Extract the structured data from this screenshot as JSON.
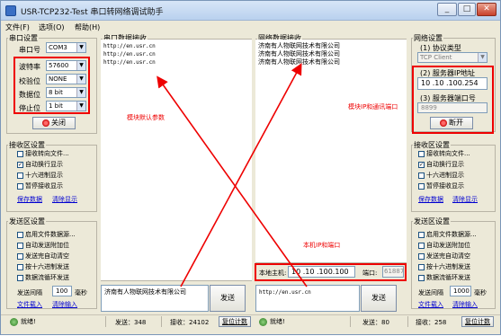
{
  "window": {
    "title": "USR-TCP232-Test 串口转网络调试助手",
    "min_label": "_",
    "max_label": "□",
    "close_label": "✕"
  },
  "menu": [
    "文件(F)",
    "选项(O)",
    "帮助(H)"
  ],
  "serial_settings": {
    "title": "串口设置",
    "port_label": "串口号",
    "port_value": "COM3",
    "baud_label": "波特率",
    "baud_value": "57600",
    "parity_label": "校验位",
    "parity_value": "NONE",
    "databits_label": "数据位",
    "databits_value": "8 bit",
    "stopbits_label": "停止位",
    "stopbits_value": "1 bit",
    "close_button": "关闭"
  },
  "serial_recv_settings": {
    "title": "接收区设置",
    "options": [
      {
        "label": "接收转向文件...",
        "checked": false
      },
      {
        "label": "自动换行显示",
        "checked": true
      },
      {
        "label": "十六进制显示",
        "checked": false
      },
      {
        "label": "暂停接收显示",
        "checked": false
      }
    ],
    "save_link": "保存数据",
    "clear_link": "清除显示"
  },
  "serial_send_settings": {
    "title": "发送区设置",
    "options": [
      {
        "label": "启用文件数据源...",
        "checked": false
      },
      {
        "label": "自动发送附加位",
        "checked": false
      },
      {
        "label": "发送完自动清空",
        "checked": false
      },
      {
        "label": "按十六进制发送",
        "checked": false
      },
      {
        "label": "数据流循环发送",
        "checked": false
      }
    ],
    "interval_label": "发送间隔",
    "interval_value": "100",
    "interval_unit": "毫秒",
    "load_link": "文件载入",
    "clear_link": "清除输入"
  },
  "serial_recv": {
    "title": "串口数据接收",
    "lines": [
      "http://en.usr.cn",
      "http://en.usr.cn",
      "http://en.usr.cn"
    ]
  },
  "net_recv": {
    "title": "网络数据接收",
    "lines": [
      "济南有人物联网技术有限公司",
      "济南有人物联网技术有限公司",
      "济南有人物联网技术有限公司"
    ]
  },
  "net_settings": {
    "title": "网络设置",
    "protocol_label": "(1) 协议类型",
    "protocol_value": "TCP Client",
    "server_ip_label": "(2) 服务器IP地址",
    "server_ip_value": "10 .10 .100.254",
    "server_port_label": "(3) 服务器端口号",
    "server_port_value": "8899",
    "connect_button": "断开"
  },
  "net_recv_settings": {
    "title": "接收区设置",
    "options": [
      {
        "label": "接收转向文件...",
        "checked": false
      },
      {
        "label": "自动换行显示",
        "checked": true
      },
      {
        "label": "十六进制显示",
        "checked": false
      },
      {
        "label": "暂停接收显示",
        "checked": false
      }
    ],
    "save_link": "保存数据",
    "clear_link": "清除显示"
  },
  "net_send_settings": {
    "title": "发送区设置",
    "options": [
      {
        "label": "启用文件数据源...",
        "checked": false
      },
      {
        "label": "自动发送附加位",
        "checked": false
      },
      {
        "label": "发送完自动清空",
        "checked": false
      },
      {
        "label": "按十六进制发送",
        "checked": false
      },
      {
        "label": "数据流循环发送",
        "checked": false
      }
    ],
    "interval_label": "发送间隔",
    "interval_value": "1000",
    "interval_unit": "毫秒",
    "load_link": "文件载入",
    "clear_link": "清除输入"
  },
  "local_host": {
    "host_label": "本地主机:",
    "host_value": "10 .10 .100.100",
    "port_label": "端口:",
    "port_value": "61887"
  },
  "serial_send": {
    "text": "济南有人物联网技术有限公司",
    "button": "发送"
  },
  "net_send": {
    "text": "http://en.usr.cn",
    "button": "发送"
  },
  "annotations": {
    "module_defaults": "模块默认参数",
    "module_ip_port": "模块IP和通讯端口",
    "local_ip_port": "本机IP和端口"
  },
  "status": {
    "left_ready": "就绪!",
    "left_send": "发送：348",
    "left_recv": "接收：24102",
    "left_reset": "复位计数",
    "right_ready": "就绪!",
    "right_send": "发送：80",
    "right_recv": "接收：258",
    "right_reset": "复位计数"
  },
  "colors": {
    "annotation": "#e00000",
    "link": "#0000d0"
  }
}
